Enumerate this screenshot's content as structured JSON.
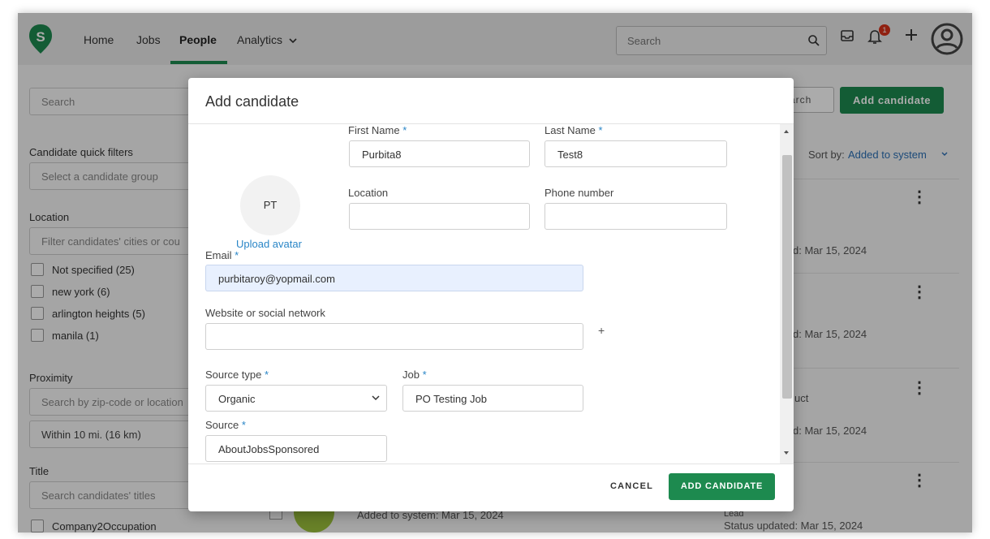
{
  "nav": {
    "links": [
      "Home",
      "Jobs",
      "People",
      "Analytics"
    ],
    "search_placeholder": "Search",
    "notification_count": "1",
    "accent_color": "#1d8a4f"
  },
  "background": {
    "search_placeholder": "Search",
    "search_button": "arch",
    "add_candidate_button": "Add candidate",
    "sort_label": "Sort by:",
    "sort_value": "Added to system",
    "sidebar": {
      "quick_filters_label": "Candidate quick filters",
      "quick_filters_placeholder": "Select a candidate group",
      "location_label": "Location",
      "location_placeholder": "Filter candidates' cities or cou",
      "location_options": [
        "Not specified (25)",
        "new york (6)",
        "arlington heights (5)",
        "manila (1)"
      ],
      "proximity_label": "Proximity",
      "proximity_placeholder": "Search by zip-code or location",
      "proximity_value": "Within 10 mi. (16 km)",
      "title_label": "Title",
      "title_placeholder": "Search candidates' titles",
      "title_option": "Company2Occupation"
    },
    "rows": [
      {
        "date": "d: Mar 15, 2024"
      },
      {
        "date": "d: Mar 15, 2024"
      },
      {
        "extra": "uct",
        "date": "d: Mar 15, 2024"
      }
    ],
    "last_row": {
      "added": "Added to system: Mar 15, 2024",
      "status": "Status updated: Mar 15, 2024",
      "partial": "Lead"
    }
  },
  "modal": {
    "title": "Add candidate",
    "avatar_initials": "PT",
    "upload_avatar": "Upload avatar",
    "required_mark": "*",
    "fields": {
      "first_name": {
        "label": "First Name",
        "value": "Purbita8"
      },
      "last_name": {
        "label": "Last Name",
        "value": "Test8"
      },
      "location": {
        "label": "Location",
        "value": ""
      },
      "phone": {
        "label": "Phone number",
        "value": ""
      },
      "email": {
        "label": "Email",
        "value": "purbitaroy@yopmail.com"
      },
      "website": {
        "label": "Website or social network",
        "value": ""
      },
      "source_type": {
        "label": "Source type",
        "value": "Organic"
      },
      "job": {
        "label": "Job",
        "value": "PO Testing Job"
      },
      "source": {
        "label": "Source",
        "value": "AboutJobsSponsored"
      }
    },
    "add_link": "+",
    "cancel": "CANCEL",
    "submit": "ADD CANDIDATE"
  }
}
